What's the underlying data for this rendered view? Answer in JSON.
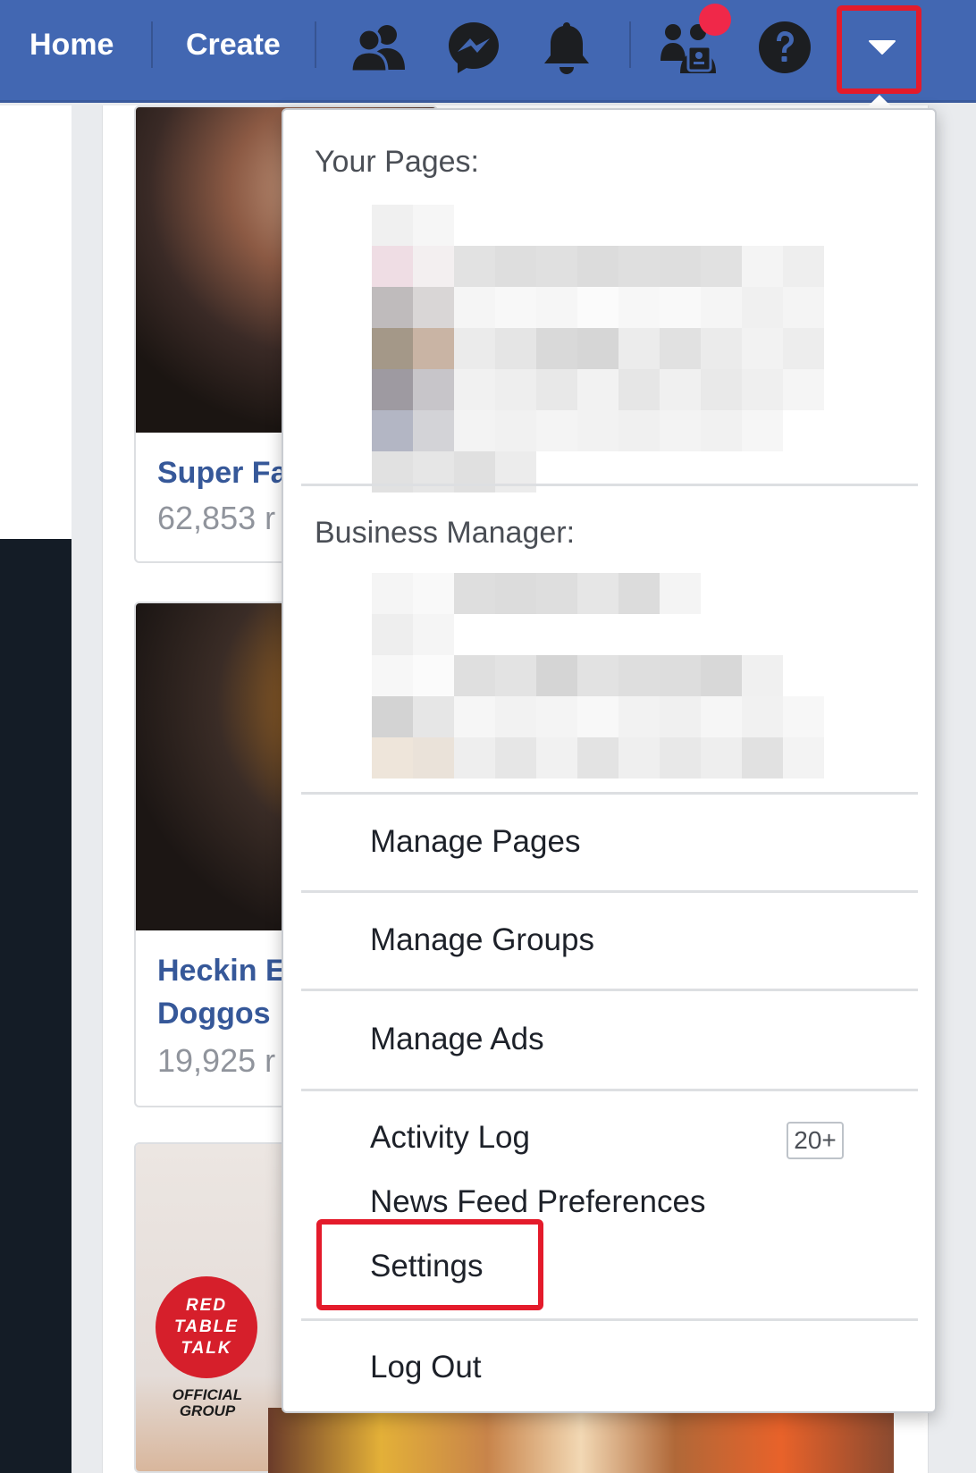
{
  "topbar": {
    "home_label": "Home",
    "create_label": "Create",
    "icons": [
      "friend-requests-icon",
      "messenger-icon",
      "notifications-icon",
      "find-friends-icon",
      "help-icon",
      "account-menu-caret-icon"
    ],
    "background_color": "#4267b2",
    "notification_dot_color": "#f02849"
  },
  "groups": [
    {
      "name": "Super Fa",
      "members": "62,853 r"
    },
    {
      "name_line1": "Heckin E",
      "name_line2": "Doggos",
      "members": "19,925 r"
    },
    {
      "badge_lines": [
        "RED",
        "TABLE",
        "TALK"
      ],
      "badge_sub": "OFFICIAL GROUP"
    }
  ],
  "menu": {
    "your_pages_heading": "Your Pages:",
    "business_manager_heading": "Business Manager:",
    "items": {
      "manage_pages": "Manage Pages",
      "manage_groups": "Manage Groups",
      "manage_ads": "Manage Ads",
      "activity_log": "Activity Log",
      "activity_log_count": "20+",
      "news_feed_preferences": "News Feed Preferences",
      "settings": "Settings",
      "log_out": "Log Out"
    }
  },
  "annotation_color": "#e41b2b"
}
